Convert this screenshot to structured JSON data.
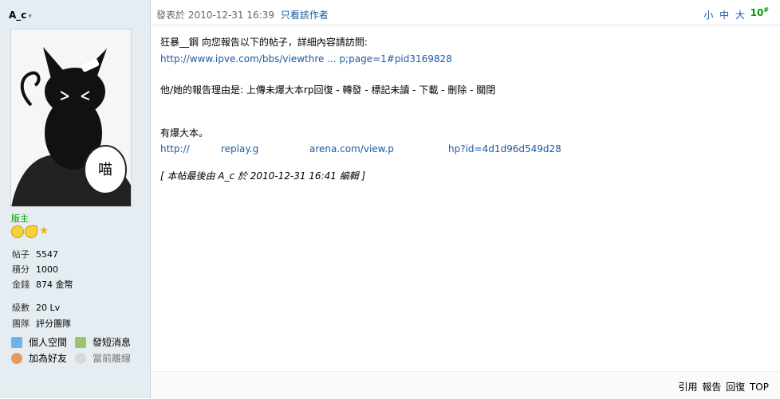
{
  "author": {
    "name": "A_c",
    "caret": "▾",
    "rank": "版主"
  },
  "stats": [
    {
      "k": "帖子",
      "v": "5547"
    },
    {
      "k": "積分",
      "v": "1000"
    },
    {
      "k": "金錢",
      "v": "874 金幣"
    },
    {
      "k": "級數",
      "v": "20 Lv"
    },
    {
      "k": "團隊",
      "v": "評分團隊"
    }
  ],
  "profile_links": {
    "space": "個人空間",
    "pm": "發短消息",
    "add_friend": "加為好友",
    "status": "當前離線"
  },
  "avatar_text": "喵",
  "header": {
    "posted": "發表於 2010-12-31 16:39",
    "only_author": "只看該作者",
    "font_sizes": "小 中 大",
    "floor": "10",
    "floor_sup": "#"
  },
  "body": {
    "line1": "狂暴__鋼 向您報告以下的帖子，詳細內容請訪問:",
    "line2_link": "http://www.ipve.com/bbs/viewthre ... p;page=1#pid3169828",
    "line3": "他/她的報告理由是: 上傳未爆大本rp回復 - 轉發 - 標記未讀 - 下載 - 刪除 - 關閉",
    "line4": "有爆大本。",
    "line5_a": "http://",
    "line5_b": "replay.g",
    "line5_c": "arena.com/view.p",
    "line5_d": "hp?id=4d1d96d549d28",
    "edited": "[ 本帖最後由 A_c 於 2010-12-31 16:41 編輯 ]"
  },
  "footer": {
    "links": "引用 報告 回復 TOP"
  },
  "colors": {
    "sidebar_bg": "#e5edf2",
    "link": "#1a5aa6",
    "rank": "#009900"
  }
}
